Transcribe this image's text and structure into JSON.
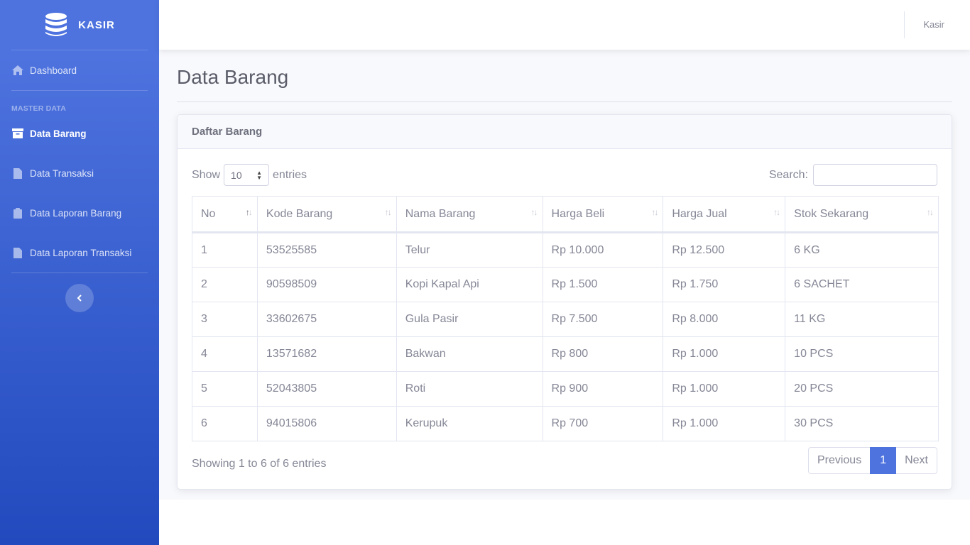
{
  "sidebar": {
    "brand": "KASIR",
    "dashboard_label": "Dashboard",
    "heading": "MASTER DATA",
    "items": [
      {
        "label": "Data Barang",
        "icon": "box-icon",
        "active": true
      },
      {
        "label": "Data Transaksi",
        "icon": "file-icon",
        "active": false
      },
      {
        "label": "Data Laporan Barang",
        "icon": "clipboard-icon",
        "active": false
      },
      {
        "label": "Data Laporan Transaksi",
        "icon": "file-icon",
        "active": false
      }
    ]
  },
  "topbar": {
    "user": "Kasir"
  },
  "page": {
    "title": "Data Barang"
  },
  "card": {
    "header": "Daftar Barang",
    "show_label": "Show",
    "entries_label": "entries",
    "page_length": "10",
    "search_label": "Search:",
    "search_value": ""
  },
  "table": {
    "columns": [
      "No",
      "Kode Barang",
      "Nama Barang",
      "Harga Beli",
      "Harga Jual",
      "Stok Sekarang"
    ],
    "rows": [
      [
        "1",
        "53525585",
        "Telur",
        "Rp 10.000",
        "Rp 12.500",
        "6 KG"
      ],
      [
        "2",
        "90598509",
        "Kopi Kapal Api",
        "Rp 1.500",
        "Rp 1.750",
        "6 SACHET"
      ],
      [
        "3",
        "33602675",
        "Gula Pasir",
        "Rp 7.500",
        "Rp 8.000",
        "11 KG"
      ],
      [
        "4",
        "13571682",
        "Bakwan",
        "Rp 800",
        "Rp 1.000",
        "10 PCS"
      ],
      [
        "5",
        "52043805",
        "Roti",
        "Rp 900",
        "Rp 1.000",
        "20 PCS"
      ],
      [
        "6",
        "94015806",
        "Kerupuk",
        "Rp 700",
        "Rp 1.000",
        "30 PCS"
      ]
    ]
  },
  "footer": {
    "info": "Showing 1 to 6 of 6 entries",
    "previous": "Previous",
    "current_page": "1",
    "next": "Next"
  },
  "colors": {
    "primary": "#4e73df",
    "primary_dark": "#224abe",
    "text": "#858796"
  }
}
